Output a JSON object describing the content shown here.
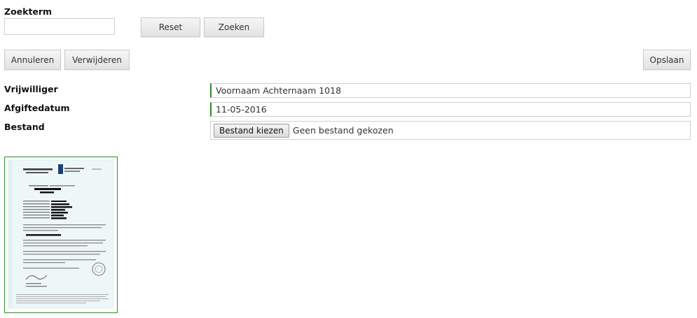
{
  "search": {
    "label": "Zoekterm",
    "value": "",
    "placeholder": "",
    "reset_label": "Reset",
    "search_label": "Zoeken"
  },
  "actions": {
    "cancel_label": "Annuleren",
    "delete_label": "Verwijderen",
    "save_label": "Opslaan"
  },
  "form": {
    "volunteer_label": "Vrijwilliger",
    "volunteer_value": "Voornaam Achternaam 1018",
    "date_label": "Afgiftedatum",
    "date_value": "11-05-2016",
    "file_label": "Bestand",
    "file_button": "Bestand kiezen",
    "file_status": "Geen bestand gekozen"
  },
  "colors": {
    "valid_accent": "#2e8b2e"
  },
  "preview": {
    "icon": "document-thumbnail"
  }
}
